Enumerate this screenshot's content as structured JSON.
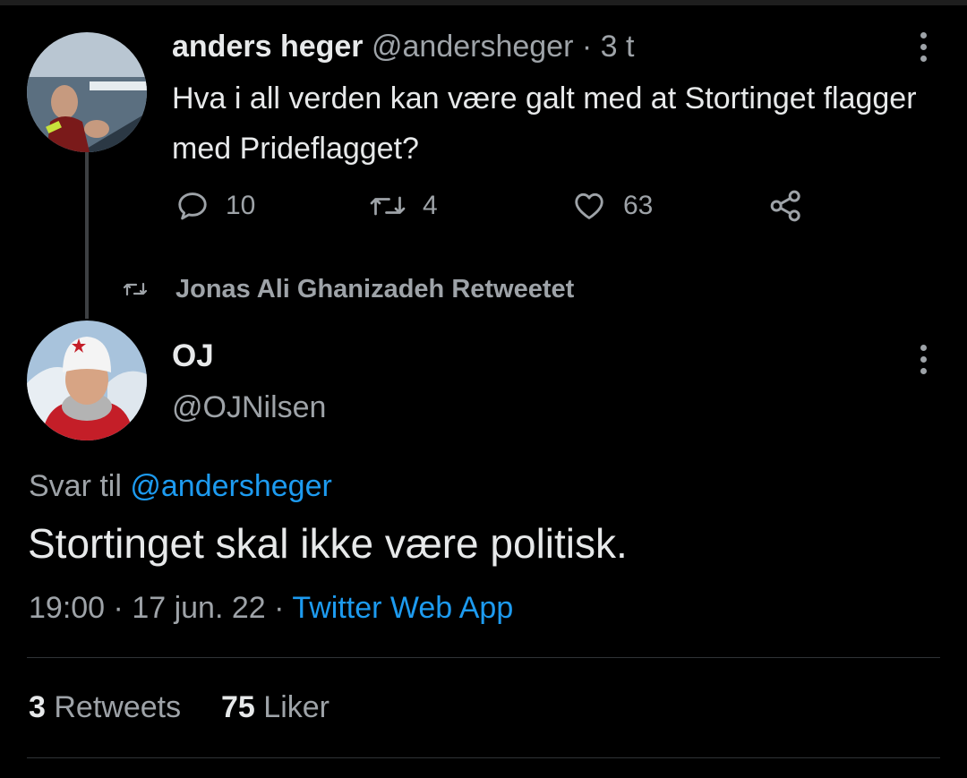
{
  "tweet1": {
    "name": "anders heger",
    "handle": "@andersheger",
    "separator": "·",
    "time": "3 t",
    "text": "Hva i all verden kan være galt med at Stortinget flagger med Prideflagget?",
    "actions": {
      "replies": "10",
      "retweets": "4",
      "likes": "63"
    }
  },
  "retweeted_by": "Jonas Ali Ghanizadeh Retweetet",
  "tweet2": {
    "name": "OJ",
    "handle": "@OJNilsen",
    "reply_prefix": "Svar til",
    "reply_to": "@andersheger",
    "text": "Stortinget skal ikke være politisk.",
    "time": "19:00",
    "sep1": "·",
    "date": "17 jun. 22",
    "sep2": "·",
    "source": "Twitter Web App",
    "stats": {
      "retweets_count": "3",
      "retweets_label": "Retweets",
      "likes_count": "75",
      "likes_label": "Liker"
    }
  },
  "icons": [
    "reply-icon",
    "retweet-icon",
    "like-icon",
    "share-icon",
    "more-icon",
    "retweeted-icon"
  ],
  "colors": {
    "background": "#000000",
    "text": "#e7e9ea",
    "muted": "#9ea3a8",
    "link": "#1d9bf0"
  }
}
